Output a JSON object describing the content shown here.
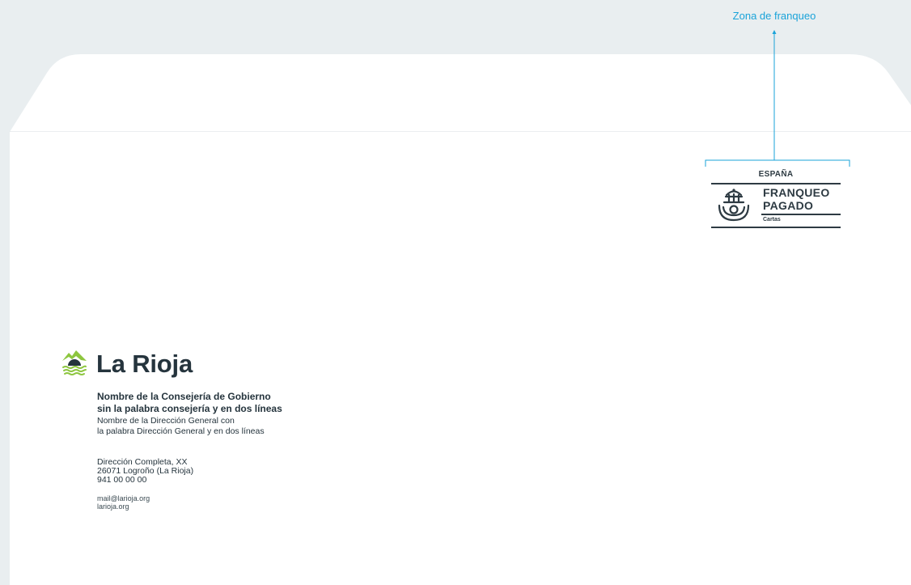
{
  "postage_zone": {
    "label": "Zona de franqueo"
  },
  "stamp": {
    "country": "ESPAÑA",
    "line1": "FRANQUEO",
    "line2": "PAGADO",
    "category": "Cartas",
    "icon": "post-horn-crown-icon"
  },
  "sender": {
    "logo_name": "La Rioja",
    "logo_icon": "mountains-sun-water-icon",
    "consejeria_line1": "Nombre de la Consejería de Gobierno",
    "consejeria_line2": "sin la palabra consejería y en dos líneas",
    "direccion_general_line1": "Nombre de la Dirección General con",
    "direccion_general_line2": "la palabra Dirección General y en dos líneas",
    "address_line1": "Dirección Completa, XX",
    "address_line2": "26071 Logroño (La Rioja)",
    "phone": "941 00 00 00",
    "email": "mail@larioja.org",
    "website": "larioja.org"
  },
  "colors": {
    "background": "#e9eef0",
    "envelope": "#ffffff",
    "accent": "#1aa3d9",
    "logo_green": "#8dc63f",
    "text": "#25343d"
  }
}
